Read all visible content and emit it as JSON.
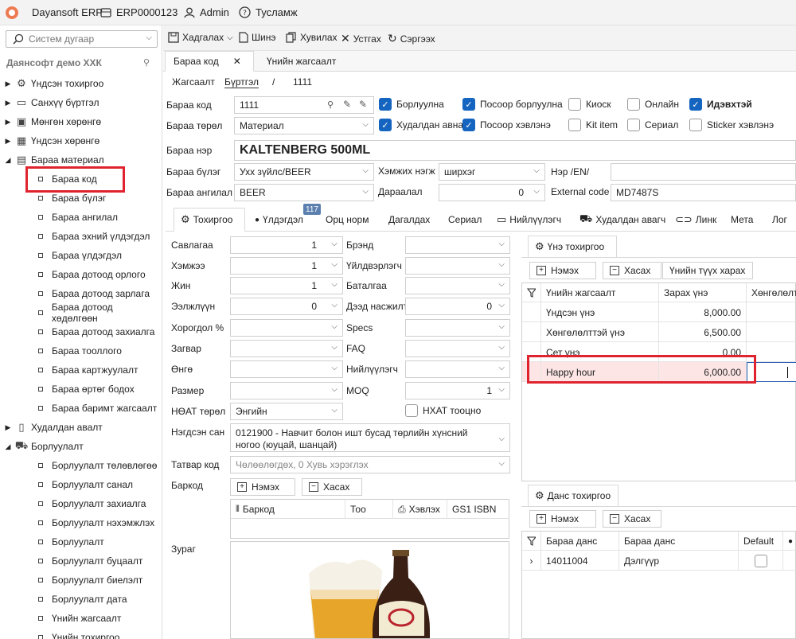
{
  "titlebar": {
    "app": "Dayansoft ERP",
    "erp_id": "ERP0000123",
    "user": "Admin",
    "help": "Тусламж"
  },
  "sidebar": {
    "search_placeholder": "Систем дугаар",
    "company": "Даянсофт демо ХХК",
    "roots": [
      {
        "label": "Үндсэн тохиргоо",
        "icon": "gear-icon",
        "glyph": "⚙"
      },
      {
        "label": "Санхүү бүртгэл",
        "icon": "ledger-icon",
        "glyph": "▭"
      },
      {
        "label": "Мөнгөн хөрөнгө",
        "icon": "money-icon",
        "glyph": "▣"
      },
      {
        "label": "Үндсэн хөрөнгө",
        "icon": "building-icon",
        "glyph": "▦"
      },
      {
        "label": "Бараа материал",
        "icon": "box-icon",
        "glyph": "▤"
      }
    ],
    "material_children": [
      "Бараа код",
      "Бараа бүлэг",
      "Бараа ангилал",
      "Бараа эхний үлдэгдэл",
      "Бараа үлдэгдэл",
      "Бараа дотоод орлого",
      "Бараа дотоод зарлага",
      "Бараа дотоод хөдөлгөөн",
      "Бараа дотоод захиалга",
      "Бараа тооллого",
      "Бараа картжуулалт",
      "Бараа өртөг бодох",
      "Бараа баримт жагсаалт"
    ],
    "roots2": [
      {
        "label": "Худалдан авалт",
        "icon": "purchase-icon",
        "glyph": "▯"
      },
      {
        "label": "Борлуулалт",
        "icon": "cart-icon",
        "glyph": "⛟"
      }
    ],
    "sales_children": [
      "Борлуулалт төлөвлөгөө",
      "Борлуулалт санал",
      "Борлуулалт захиалга",
      "Борлуулалт нэхэмжлэх",
      "Борлуулалт",
      "Борлуулалт буцаалт",
      "Борлуулалт биелэлт",
      "Борлуулалт дата",
      "Үнийн жагсаалт",
      "Үнийн тохиргоо"
    ]
  },
  "toolbar": {
    "save": "Хадгалах",
    "new": "Шинэ",
    "copy": "Хувилах",
    "delete": "Устгах",
    "refresh": "Сэргээх"
  },
  "doc_tabs": [
    "Бараа код",
    "Үнийн жагсаалт"
  ],
  "breadcrumb": {
    "list": "Жагсаалт",
    "register": "Бүртгэл",
    "sep": "/",
    "id": "1111"
  },
  "form": {
    "code_label": "Бараа код",
    "code_value": "1111",
    "type_label": "Бараа төрөл",
    "type_value": "Материал",
    "name_label": "Бараа нэр",
    "name_value": "KALTENBERG 500ML",
    "group_label": "Бараа бүлэг",
    "group_value": "Ухх зүйлс/BEER",
    "unit_label": "Хэмжих нэгж",
    "unit_value": "ширхэг",
    "name_en_label": "Нэр /EN/",
    "name_en_value": "",
    "category_label": "Бараа ангилал",
    "category_value": "BEER",
    "order_label": "Дараалал",
    "order_value": "0",
    "ext_label": "External code",
    "ext_value": "MD7487S"
  },
  "checks": [
    {
      "label": "Борлуулна",
      "on": true
    },
    {
      "label": "Посоор борлуулна",
      "on": true
    },
    {
      "label": "Киоск",
      "on": false
    },
    {
      "label": "Онлайн",
      "on": false
    },
    {
      "label": "Идэвхтэй",
      "on": true
    },
    {
      "label": "Худалдан авна",
      "on": true
    },
    {
      "label": "Посоор хэвлэнэ",
      "on": true
    },
    {
      "label": "Kit item",
      "on": false
    },
    {
      "label": "Сериал",
      "on": false
    },
    {
      "label": "Sticker хэвлэнэ",
      "on": false
    }
  ],
  "sub_tabs": [
    "Тохиргоо",
    "Үлдэгдэл",
    "Орц норм",
    "Дагалдах",
    "Сериал",
    "Нийлүүлэгч",
    "Худалдан авагч",
    "Линк",
    "Мета",
    "Лог"
  ],
  "badge": "117",
  "settings_left": [
    {
      "label": "Савлагаа",
      "value": "1"
    },
    {
      "label": "Хэмжээ",
      "value": "1"
    },
    {
      "label": "Жин",
      "value": "1"
    },
    {
      "label": "Ээлжлүүн",
      "value": "0"
    },
    {
      "label": "Хорогдол %",
      "value": ""
    },
    {
      "label": "Загвар",
      "value": ""
    },
    {
      "label": "Өнгө",
      "value": ""
    },
    {
      "label": "Размер",
      "value": ""
    },
    {
      "label": "НӨАТ төрөл",
      "value": "Энгийн"
    }
  ],
  "settings_right": [
    {
      "label": "Брэнд",
      "value": ""
    },
    {
      "label": "Үйлдвэрлэгч",
      "value": ""
    },
    {
      "label": "Баталгаа",
      "value": ""
    },
    {
      "label": "Дээд насжилт",
      "value": "0"
    },
    {
      "label": "Specs",
      "value": ""
    },
    {
      "label": "FAQ",
      "value": ""
    },
    {
      "label": "Нийлүүлэгч",
      "value": ""
    },
    {
      "label": "MOQ",
      "value": "1"
    }
  ],
  "nhat_check": "НХАТ тооцно",
  "classification_label": "Нэгдсэн сан",
  "classification_value": "0121900 - Навчит болон ишт бусад төрлийн хүнсний ногоо (юуцай, шанцай)",
  "tax_label": "Татвар код",
  "tax_value": "Чөлөөлөгдөх, 0 Хувь хэрэглэх",
  "barcode_label": "Баркод",
  "image_label": "Зураг",
  "barcode_cols": [
    "Баркод",
    "Тоо",
    "Хэвлэх",
    "GS1 ISBN"
  ],
  "add": "Нэмэх",
  "remove": "Хасах",
  "price_panel": {
    "title": "Үнэ тохиргоо",
    "history": "Үнийн түүх харах",
    "cols": [
      "Үнийн жагсаалт",
      "Зарах үнэ",
      "Хөнгөлөлт"
    ],
    "rows": [
      {
        "name": "Үндсэн үнэ",
        "price": "8,000.00"
      },
      {
        "name": "Хөнгөлөлттэй үнэ",
        "price": "6,500.00"
      },
      {
        "name": "Сет үнэ",
        "price": "0.00"
      },
      {
        "name": "Happy hour",
        "price": "6,000.00"
      }
    ]
  },
  "account_panel": {
    "title": "Данс тохиргоо",
    "cols": [
      "Бараа данс",
      "Бараа данс",
      "Default"
    ],
    "rows": [
      {
        "code": "14011004",
        "name": "Дэлгүүр"
      }
    ]
  }
}
